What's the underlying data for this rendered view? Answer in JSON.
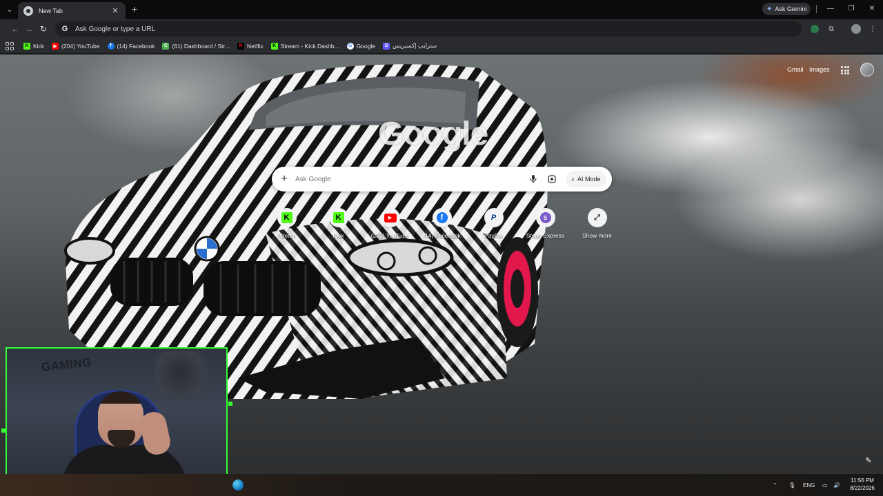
{
  "browser": {
    "tab": {
      "title": "New Tab"
    },
    "gemini_button": "Ask Gemini",
    "omnibox": {
      "placeholder": "Ask Google or type a URL"
    }
  },
  "bookmarks": [
    {
      "label": "Kick",
      "icon": "kick-icon",
      "color": "#53fc18"
    },
    {
      "label": "(204) YouTube",
      "icon": "youtube-icon",
      "color": "#ff0000"
    },
    {
      "label": "(14) Facebook",
      "icon": "facebook-icon",
      "color": "#1877f2"
    },
    {
      "label": "(61) Dashboard / Str...",
      "icon": "dashboard-icon",
      "color": "#4caf50"
    },
    {
      "label": "Netflix",
      "icon": "netflix-icon",
      "color": "#e50914"
    },
    {
      "label": "Stream - Kick Dashb...",
      "icon": "kick-icon",
      "color": "#53fc18"
    },
    {
      "label": "Google",
      "icon": "google-icon",
      "color": "#ffffff"
    },
    {
      "label": "سترايب إكسبريس",
      "icon": "stripe-icon",
      "color": "#635bff"
    }
  ],
  "ntp": {
    "gmail": "Gmail",
    "images": "Images",
    "logo": "Google",
    "search_placeholder": "Ask Google",
    "ai_mode": "AI Mode",
    "shortcuts": [
      {
        "label": "Stream",
        "icon": "kick-icon",
        "glyph": "K",
        "color": "#53fc18"
      },
      {
        "label": "Kick",
        "icon": "kick-icon",
        "glyph": "K",
        "color": "#53fc18"
      },
      {
        "label": "(222) YouTube",
        "icon": "youtube-icon",
        "glyph": "▶",
        "color": "#ff0000"
      },
      {
        "label": "(14) Facebook",
        "icon": "facebook-icon",
        "glyph": "f",
        "color": "#1877f2"
      },
      {
        "label": "PayPal",
        "icon": "paypal-icon",
        "glyph": "P",
        "color": "#003087"
      },
      {
        "label": "Stripe Express",
        "icon": "stripe-icon",
        "glyph": "S",
        "color": "#635bff"
      },
      {
        "label": "Show more",
        "icon": "expand-icon",
        "glyph": "⤢",
        "color": "#303134"
      }
    ]
  },
  "webcam": {
    "wall_text": "GAMING"
  },
  "taskbar": {
    "language": "ENG",
    "time": "11:56 PM",
    "date": "8/22/2026"
  }
}
